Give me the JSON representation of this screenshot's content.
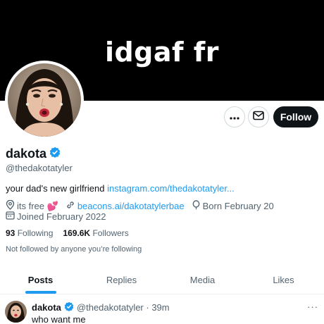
{
  "banner": {
    "text": "idgaf fr"
  },
  "actions": {
    "follow_label": "Follow"
  },
  "profile": {
    "display_name": "dakota",
    "handle": "@thedakotatyler",
    "bio_text": "your dad's new girlfriend ",
    "bio_link": "instagram.com/thedakotatyler...",
    "location": "its free 💕",
    "website": "beacons.ai/dakotatylerbae",
    "birthday": "Born February 20",
    "joined": "Joined February 2022",
    "following_count": "93",
    "following_label": "Following",
    "followers_count": "169.6K",
    "followers_label": "Followers",
    "not_followed_text": "Not followed by anyone you’re following"
  },
  "tabs": [
    {
      "label": "Posts"
    },
    {
      "label": "Replies"
    },
    {
      "label": "Media"
    },
    {
      "label": "Likes"
    }
  ],
  "tweet": {
    "name": "dakota",
    "handle_time": "@thedakotatyler · 39m",
    "text": "who want me",
    "more": "···"
  },
  "colors": {
    "accent": "#1d9bf0",
    "text": "#0f1419",
    "muted": "#536471",
    "verified": "#1d9bf0"
  },
  "icons": [
    "more-icon",
    "mail-icon",
    "verified-badge-icon",
    "location-icon",
    "link-icon",
    "birthday-icon",
    "calendar-icon"
  ]
}
